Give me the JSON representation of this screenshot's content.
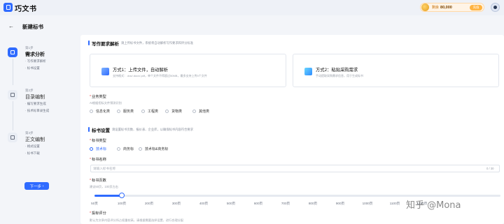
{
  "app": {
    "name": "巧文书",
    "logo_icon": "document-icon"
  },
  "header": {
    "balance_label": "剩余",
    "balance_value": "80,000",
    "recharge_label": "充值",
    "avatar_icon": "user-avatar-icon"
  },
  "page": {
    "title": "新建标书",
    "back_icon": "arrow-left-icon"
  },
  "steps": [
    {
      "no": "第1步",
      "name": "需求分析",
      "subs": [
        "写作要求解析",
        "标书设置"
      ]
    },
    {
      "no": "第2步",
      "name": "目录编制",
      "subs": [
        "编写要求生成",
        "技术标目录生成"
      ]
    },
    {
      "no": "第3步",
      "name": "正文编制",
      "subs": [
        "格式设置",
        "标书下载"
      ]
    }
  ],
  "next_button": "下一步",
  "requirement": {
    "title": "写作要求解析",
    "hint": "请上传标书文件，系统将自动解析写作要求和评分标准",
    "card_upload": {
      "title": "方式1：上传文件，自动解析",
      "desc": "支持格式：.doc/.docx/.pdf，单个文件不得超过50MB，最多支持上传5个文件"
    },
    "card_paste": {
      "title": "方式2：粘贴采购需求",
      "desc": "手动提取采购需求信息，用于生成标书"
    }
  },
  "business": {
    "label": "业务类型",
    "hint": "AI根据招标文件预测识别",
    "options": [
      "信息化类",
      "服务类",
      "工程类",
      "货物类",
      "其他类"
    ]
  },
  "bid_settings": {
    "title": "标书设置",
    "hint": "请设置标书页数、报价表、企业库，以确保标书内容符合要求",
    "type_label": "标书类型",
    "type_options": [
      "技术标",
      "商务标",
      "技术标&商务标"
    ],
    "type_selected": 0,
    "name_label": "标书名称",
    "name_placeholder": "请输入标书名称",
    "name_counter": "0 / 30",
    "pages_label": "标书页数",
    "pages_hint": "建议50页，100页左右",
    "pages_ticks": [
      "50页",
      "100页",
      "200页",
      "300页",
      "400页",
      "500页",
      "600页",
      "700页",
      "800页",
      "900页",
      "1000页",
      "1100页",
      "1200页"
    ],
    "pages_value_index": 1,
    "scoring_label": "投标评分",
    "scoring_hint": "默认为文章内容评分所占权重较高，请根据需要选择设置，进行合理分配"
  },
  "watermark": "知乎 @Mona",
  "colors": {
    "accent": "#2f6bff",
    "required": "#e54545"
  }
}
